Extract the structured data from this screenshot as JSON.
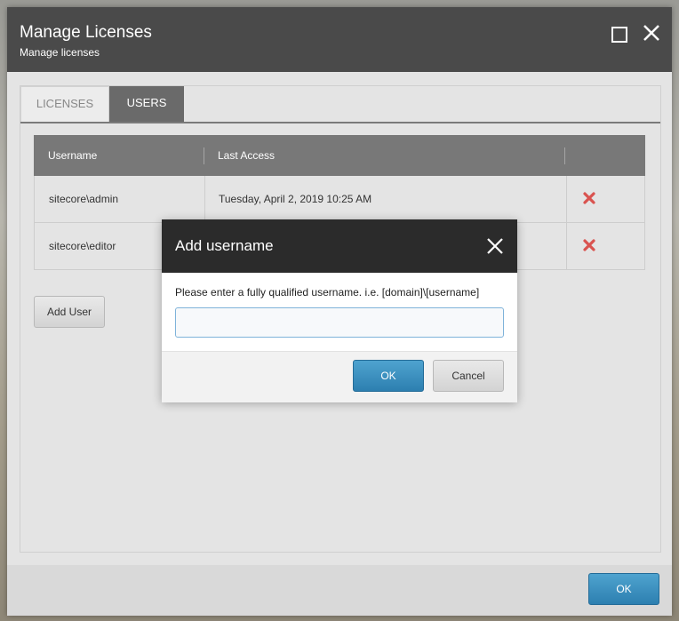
{
  "window": {
    "title": "Manage Licenses",
    "subtitle": "Manage licenses"
  },
  "tabs": [
    {
      "label": "LICENSES",
      "active": false
    },
    {
      "label": "USERS",
      "active": true
    }
  ],
  "users_table": {
    "columns": [
      "Username",
      "Last Access"
    ],
    "rows": [
      {
        "username": "sitecore\\admin",
        "last_access": "Tuesday, April 2, 2019 10:25 AM"
      },
      {
        "username": "sitecore\\editor",
        "last_access": ""
      }
    ],
    "delete_icon": "red-x-icon"
  },
  "add_user_label": "Add User",
  "footer": {
    "ok_label": "OK"
  },
  "dialog": {
    "title": "Add username",
    "prompt": "Please enter a fully qualified username. i.e. [domain]\\[username]",
    "input_value": "",
    "ok_label": "OK",
    "cancel_label": "Cancel"
  },
  "colors": {
    "accent_blue": "#2d7fb0",
    "delete_red": "#d9534f",
    "titlebar": "#4a4a4a"
  }
}
